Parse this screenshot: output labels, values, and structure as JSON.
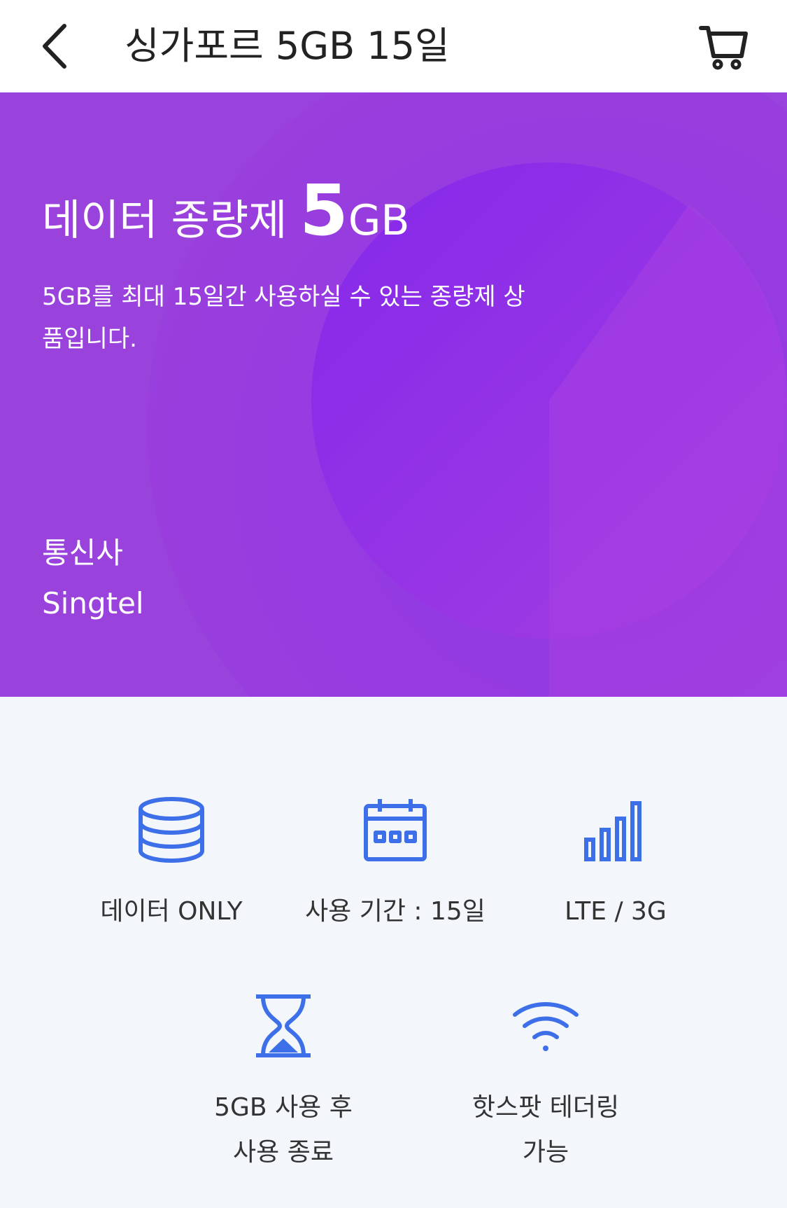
{
  "header": {
    "title": "싱가포르 5GB 15일",
    "back_icon": "chevron-left-icon",
    "cart_icon": "cart-icon"
  },
  "hero": {
    "headline_prefix": "데이터 종량제",
    "headline_amount": "5",
    "headline_unit": "GB",
    "description": "5GB를 최대 15일간 사용하실 수 있는 종량제 상품입니다.",
    "carrier_label": "통신사",
    "carrier_value": "Singtel",
    "colors": {
      "background": "#9a40dc",
      "circle": "#8a2ee6",
      "accent": "#a93ee0"
    }
  },
  "features": [
    {
      "icon": "database-icon",
      "label": "데이터 ONLY"
    },
    {
      "icon": "calendar-icon",
      "label": "사용 기간 : 15일"
    },
    {
      "icon": "signal-icon",
      "label": "LTE / 3G"
    },
    {
      "icon": "hourglass-icon",
      "label_line1": "5GB 사용 후",
      "label_line2": "사용 종료"
    },
    {
      "icon": "wifi-icon",
      "label_line1": "핫스팟 테더링",
      "label_line2": "가능"
    }
  ],
  "colors": {
    "icon_blue": "#3d6fe8",
    "text_dark": "#222222"
  }
}
